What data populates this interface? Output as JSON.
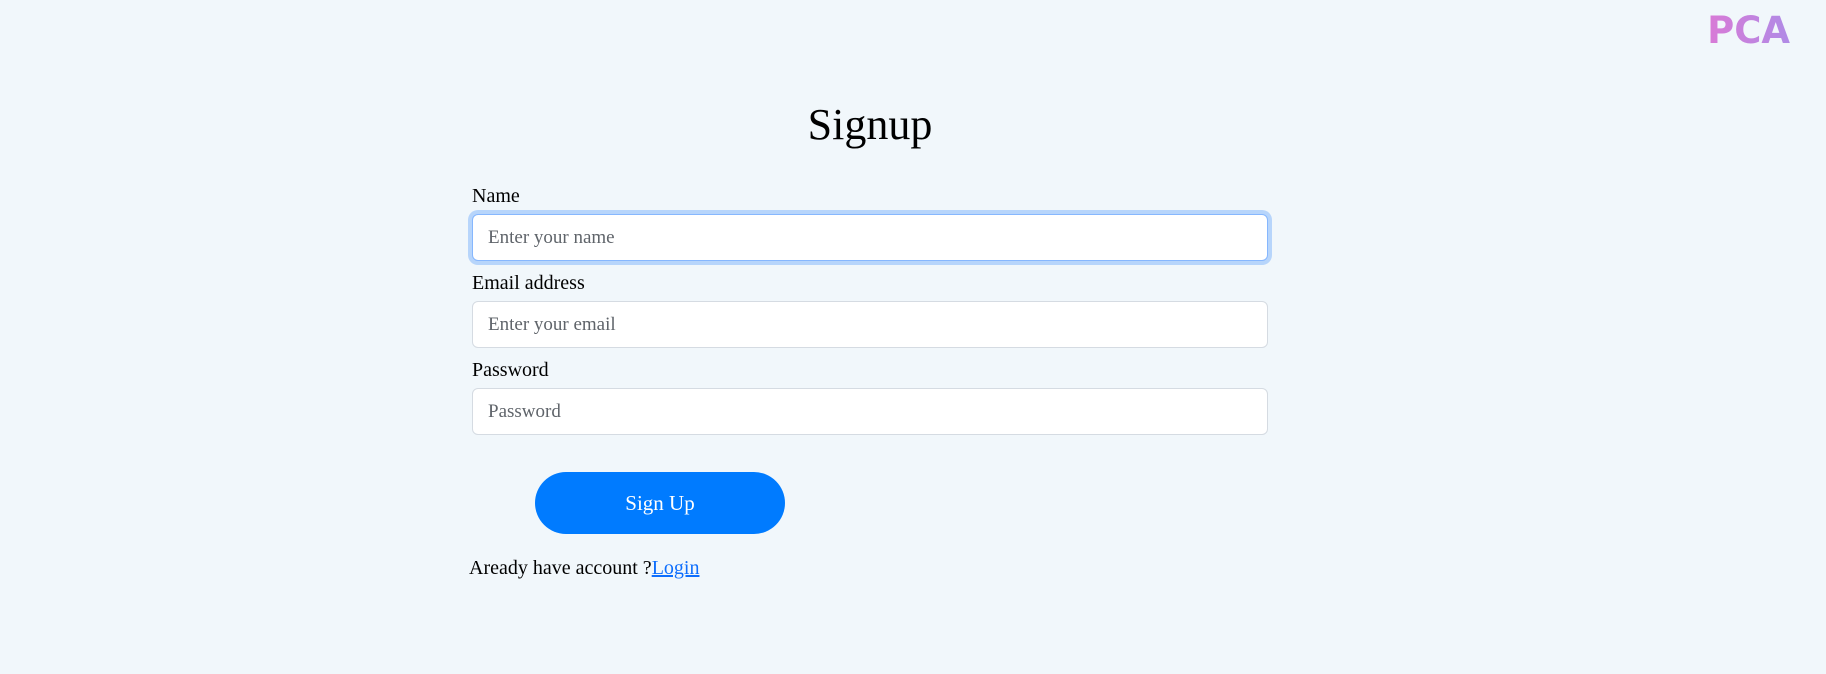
{
  "brand": {
    "logo_text": "PCA"
  },
  "page": {
    "title": "Signup"
  },
  "form": {
    "name": {
      "label": "Name",
      "placeholder": "Enter your name",
      "value": ""
    },
    "email": {
      "label": "Email address",
      "placeholder": "Enter your email",
      "value": ""
    },
    "password": {
      "label": "Password",
      "placeholder": "Password",
      "value": ""
    },
    "submit_label": "Sign Up"
  },
  "footer": {
    "prompt": "Aready have account ?",
    "login_link": "Login"
  },
  "colors": {
    "background": "#f1f7fb",
    "primary_button": "#007bff",
    "link": "#0d6efd",
    "focus_ring": "#86b7fe",
    "brand_gradient_start": "#d97ad6",
    "brand_gradient_end": "#b08be6"
  }
}
